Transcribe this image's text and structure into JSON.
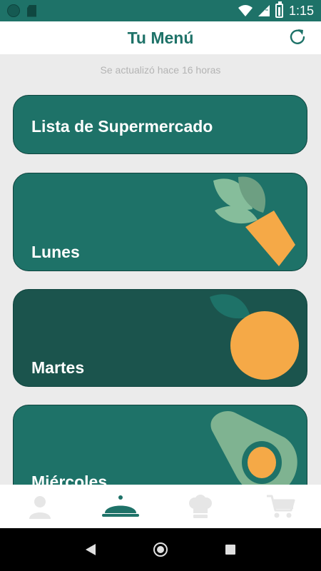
{
  "status_bar": {
    "time": "1:15"
  },
  "header": {
    "title": "Tu Menú"
  },
  "updated": "Se actualizó hace 16 horas",
  "cards": {
    "shopping": "Lista de Supermercado",
    "monday": "Lunes",
    "tuesday": "Martes",
    "wednesday": "Miércoles"
  },
  "colors": {
    "primary": "#1e7268",
    "dark_card": "#1b544d",
    "orange": "#f5a947",
    "light_green": "#7fb391"
  },
  "bottom_nav": [
    "profile-icon",
    "menu-cloche-icon",
    "chef-hat-icon",
    "cart-icon"
  ]
}
